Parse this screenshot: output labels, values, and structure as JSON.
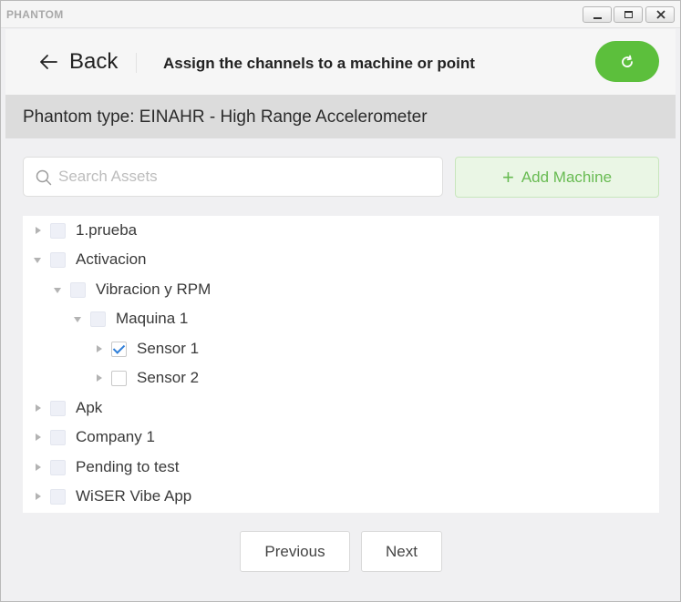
{
  "window": {
    "app_title": "PHANTOM",
    "controls": {
      "minimize": "minimize-icon",
      "maximize": "maximize-icon",
      "close": "close-icon"
    }
  },
  "header": {
    "back_label": "Back",
    "title": "Assign the channels to a machine or point",
    "refresh_icon": "refresh-icon"
  },
  "phantom_type": "Phantom type: EINAHR - High Range Accelerometer",
  "search": {
    "placeholder": "Search Assets",
    "value": ""
  },
  "add_machine": {
    "icon": "plus-icon",
    "label": "Add Machine"
  },
  "tree": {
    "nodes": [
      {
        "label": "1.prueba",
        "level": 0,
        "caret": "right",
        "checkbox": "disabled"
      },
      {
        "label": "Activacion",
        "level": 0,
        "caret": "down",
        "checkbox": "disabled"
      },
      {
        "label": "Vibracion y RPM",
        "level": 1,
        "caret": "down",
        "checkbox": "disabled"
      },
      {
        "label": "Maquina 1",
        "level": 2,
        "caret": "down",
        "checkbox": "disabled"
      },
      {
        "label": "Sensor 1",
        "level": 3,
        "caret": "right",
        "checkbox": "checked"
      },
      {
        "label": "Sensor 2",
        "level": 3,
        "caret": "right",
        "checkbox": "enabled"
      },
      {
        "label": "Apk",
        "level": 0,
        "caret": "right",
        "checkbox": "disabled"
      },
      {
        "label": "Company 1",
        "level": 0,
        "caret": "right",
        "checkbox": "disabled"
      },
      {
        "label": "Pending to test",
        "level": 0,
        "caret": "right",
        "checkbox": "disabled"
      },
      {
        "label": "WiSER Vibe App",
        "level": 0,
        "caret": "right",
        "checkbox": "disabled"
      }
    ]
  },
  "footer": {
    "previous_label": "Previous",
    "next_label": "Next"
  },
  "colors": {
    "accent_green": "#5cbf3c",
    "check_blue": "#2f7ed8"
  }
}
